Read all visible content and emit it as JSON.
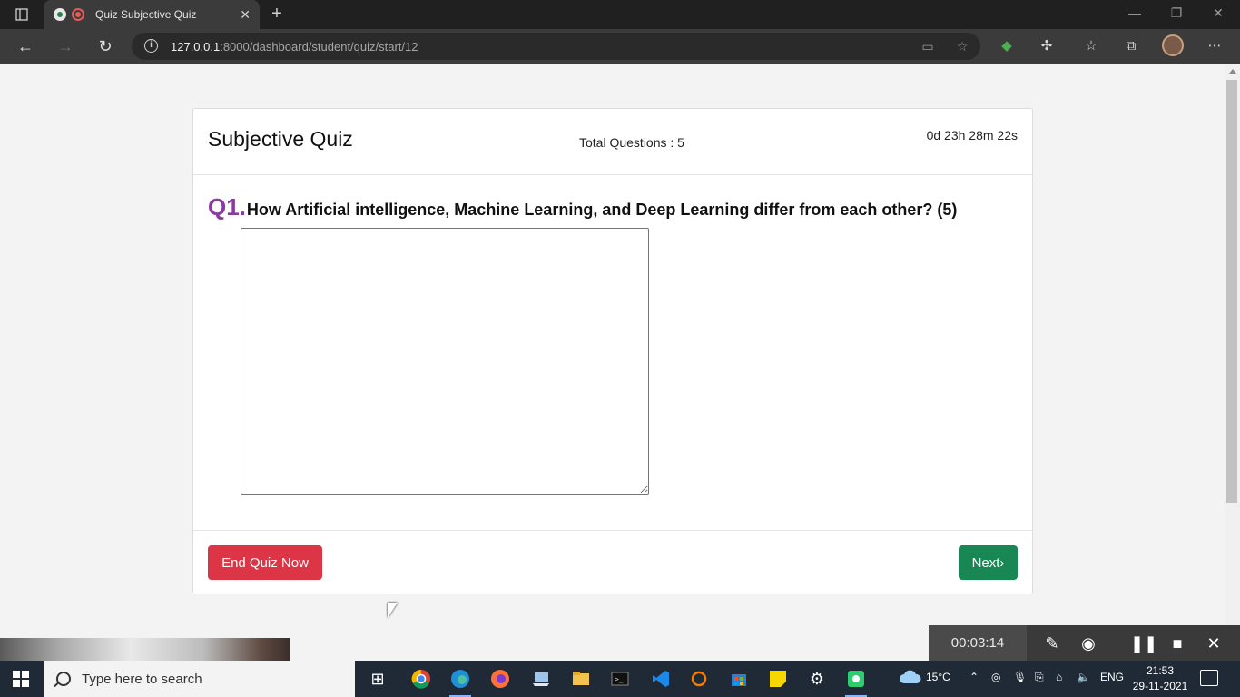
{
  "browser": {
    "tab_title": "Quiz Subjective Quiz",
    "new_tab_symbol": "+",
    "url_host": "127.0.0.1",
    "url_rest": ":8000/dashboard/student/quiz/start/12",
    "icons": [
      "tab-actions-icon",
      "back-icon",
      "forward-icon",
      "refresh-icon",
      "info-icon",
      "camera-icon",
      "favorite-add-icon",
      "extension-icon",
      "puzzle-icon",
      "favorites-icon",
      "collections-icon",
      "profile-avatar",
      "more-icon"
    ]
  },
  "quiz": {
    "title": "Subjective Quiz",
    "total_questions": "Total Questions : 5",
    "countdown": "0d 23h 28m 22s",
    "question_number": "Q1.",
    "question_text": "How Artificial intelligence, Machine Learning, and Deep Learning differ from each other? (5)",
    "answer_value": "",
    "end_button": "End Quiz Now",
    "next_button": "Next›"
  },
  "recorder": {
    "elapsed": "00:03:14",
    "icons": [
      "pen-icon",
      "camera-icon",
      "pause-icon",
      "stop-icon",
      "close-icon"
    ]
  },
  "taskbar": {
    "search_placeholder": "Type here to search",
    "weather": "15°C",
    "language": "ENG",
    "time": "21:53",
    "date": "29-11-2021",
    "colors": {
      "taskbar": "#1f2a36",
      "end_button": "#dc3545",
      "next_button": "#198754",
      "question_number": "#8b3aa1"
    }
  }
}
